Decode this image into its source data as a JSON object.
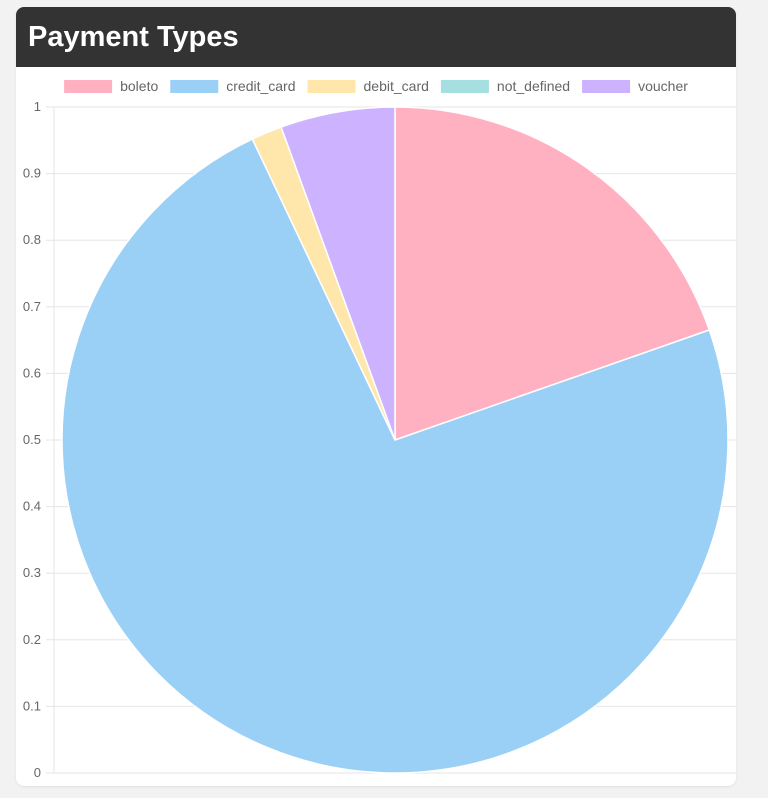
{
  "header": {
    "title": "Payment Types"
  },
  "chart_data": {
    "type": "pie",
    "title": "Payment Types",
    "categories": [
      "boleto",
      "credit_card",
      "debit_card",
      "not_defined",
      "voucher"
    ],
    "values": [
      19.8,
      73.9,
      1.5,
      0.0,
      5.6
    ],
    "colors": [
      "#ffb1c1",
      "#9ad0f5",
      "#ffe6aa",
      "#a5dfdf",
      "#ccb2ff"
    ],
    "legend_position": "top",
    "y_ticks": [
      "0",
      "0.1",
      "0.2",
      "0.3",
      "0.4",
      "0.5",
      "0.6",
      "0.7",
      "0.8",
      "0.9",
      "1"
    ],
    "ylim": [
      0,
      1
    ],
    "grid": true
  }
}
